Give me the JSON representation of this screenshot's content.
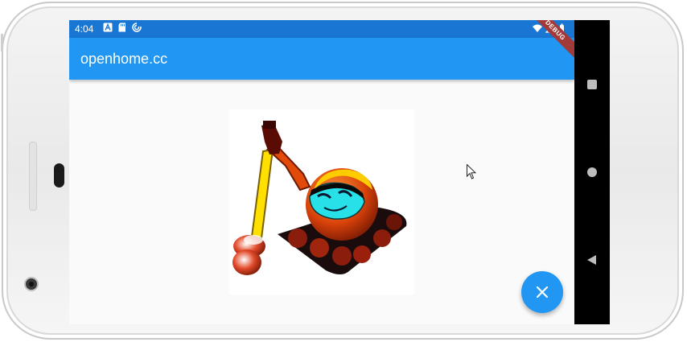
{
  "status_bar": {
    "time": "4:04",
    "left_icons": [
      "a-icon",
      "sd-card-icon",
      "sync-icon"
    ],
    "right_icons": [
      "wifi-icon",
      "signal-icon",
      "battery-icon"
    ]
  },
  "app_bar": {
    "title": "openhome.cc"
  },
  "debug_banner": "DEBUG",
  "content": {
    "image_icon": "excavator-robot-icon"
  },
  "fab": {
    "icon": "close-icon"
  },
  "nav_bar": {
    "buttons": [
      "recents-icon",
      "home-icon",
      "back-icon"
    ]
  },
  "colors": {
    "status_bar": "#1976d2",
    "app_bar": "#2196f3",
    "fab": "#2196f3",
    "background": "#fafafa",
    "debug_banner": "#a33a3a"
  }
}
